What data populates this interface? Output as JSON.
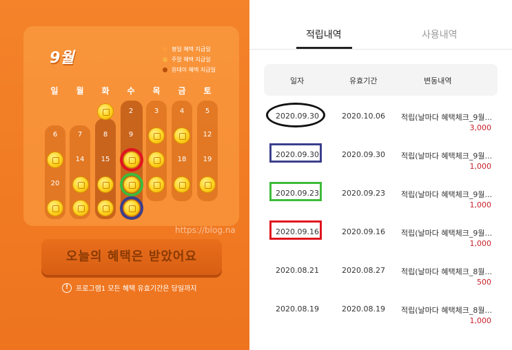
{
  "calendar": {
    "month": "9월",
    "legend": [
      "평일 혜택 지급일",
      "주말 혜택 지급일",
      "원데이 혜택 지급일"
    ],
    "weekdays": [
      "일",
      "월",
      "화",
      "수",
      "목",
      "금",
      "토"
    ],
    "days": [
      "2",
      "3",
      "4",
      "5",
      "6",
      "7",
      "8",
      "9",
      "12",
      "14",
      "15",
      "18",
      "19",
      "20"
    ],
    "button_label": "오늘의 혜택은 받았어요",
    "notice": "프로그램1 모든 혜택 유효기간은 당일까지",
    "watermark": "https://blog.na"
  },
  "colors": {
    "legend_weekday": "#ff9a3a",
    "legend_weekend": "#f7b040",
    "legend_oneday": "#b8500c",
    "red_circle": "#e0141e",
    "green_circle": "#3dbb3a",
    "navy_circle": "#3a3f8c",
    "amount": "#c8202a"
  },
  "tabs": [
    "적립내역",
    "사용내역"
  ],
  "table": {
    "headers": [
      "일자",
      "유효기간",
      "변동내역"
    ],
    "rows": [
      {
        "date": "2020.09.30",
        "expiry": "2020.10.06",
        "desc": "적립(날마다 혜택체크_9월...",
        "amount": "3,000"
      },
      {
        "date": "2020.09.30",
        "expiry": "2020.09.30",
        "desc": "적립(날마다 혜택체크_9월...",
        "amount": "1,000"
      },
      {
        "date": "2020.09.23",
        "expiry": "2020.09.23",
        "desc": "적립(날마다 혜택체크_9월...",
        "amount": "1,000"
      },
      {
        "date": "2020.09.16",
        "expiry": "2020.09.16",
        "desc": "적립(날마다 혜택체크_9월...",
        "amount": "1,000"
      },
      {
        "date": "2020.08.21",
        "expiry": "2020.08.27",
        "desc": "적립(날마다 혜택체크_8월...",
        "amount": "500"
      },
      {
        "date": "2020.08.19",
        "expiry": "2020.08.19",
        "desc": "적립(날마다 혜택체크_8월...",
        "amount": "1,000"
      }
    ]
  }
}
